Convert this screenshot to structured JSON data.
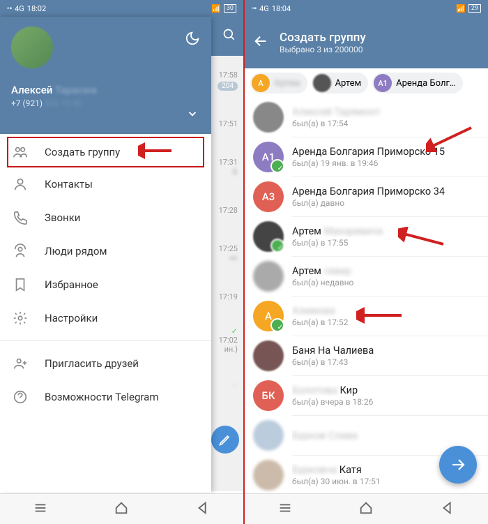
{
  "left": {
    "status": {
      "net": "4G",
      "time": "18:02",
      "battery": "30"
    },
    "drawer": {
      "name": "Алексей",
      "name_blur": "Тарасюк",
      "phone": "+7 (921)",
      "phone_blur": "305 10 40",
      "items": [
        {
          "icon": "group",
          "label": "Создать группу"
        },
        {
          "icon": "contact",
          "label": "Контакты"
        },
        {
          "icon": "call",
          "label": "Звонки"
        },
        {
          "icon": "nearby",
          "label": "Люди рядом"
        },
        {
          "icon": "bookmark",
          "label": "Избранное"
        },
        {
          "icon": "settings",
          "label": "Настройки"
        },
        {
          "icon": "invite",
          "label": "Пригласить друзей"
        },
        {
          "icon": "help",
          "label": "Возможности Telegram"
        }
      ]
    },
    "peek_times": [
      "17:58",
      "17:51",
      "17:31",
      "17:28",
      "17:25",
      "17:19",
      "17:02",
      "-"
    ],
    "peek_badge": "204",
    "peek_extra": "ин.)"
  },
  "right": {
    "status": {
      "net": "4G",
      "time": "18:04",
      "battery": "29"
    },
    "header": {
      "title": "Создать группу",
      "sub": "Выбрано 3 из 200000"
    },
    "chips": [
      {
        "initial": "А",
        "color": "#f5a623",
        "label": "Артем",
        "blur": true
      },
      {
        "initial": "",
        "color": "#666",
        "photo": true,
        "label": "Артем"
      },
      {
        "initial": "А1",
        "color": "#8e7cc3",
        "label": "Аренда Болг…"
      }
    ],
    "contacts": [
      {
        "photo": true,
        "name_blur": "Алексей Тарямонт",
        "status": "был(а) в 17:54"
      },
      {
        "initial": "А1",
        "color": "#8e7cc3",
        "checked": true,
        "name": "Аренда Болгария Приморско 15",
        "status": "был(а) 19 янв. в 19:46",
        "arrow": true
      },
      {
        "initial": "А3",
        "color": "#e06055",
        "name": "Аренда Болгария Приморско 34",
        "status": "был(а) давно"
      },
      {
        "photo": true,
        "checked": true,
        "name": "Артем",
        "name_blur_after": "Макаревича",
        "status": "был(а) в 17:55",
        "arrow": true
      },
      {
        "photo": true,
        "blur_photo": true,
        "name": "Артем",
        "name_blur_after": "север",
        "status": "был(а) недавно"
      },
      {
        "initial": "А",
        "color": "#f5a623",
        "checked": true,
        "name_blur": "Алимова",
        "status": "был(а) в 17:52",
        "arrow": true
      },
      {
        "photo": true,
        "name": "Баня На Чалиева",
        "status": "был(а) в 17:43"
      },
      {
        "initial": "БК",
        "color": "#e06055",
        "name_blur": "Болотова",
        "name_after": "Кир",
        "status": "был(а) вчера в 18:26"
      },
      {
        "photo": true,
        "blur_photo": true,
        "name_blur": "Бурков Слава",
        "status": ""
      },
      {
        "photo": true,
        "blur_photo": true,
        "name_blur": "Бурковча",
        "name_after": "Катя",
        "status": "был(а) 30 июн. в 17:51"
      }
    ]
  }
}
